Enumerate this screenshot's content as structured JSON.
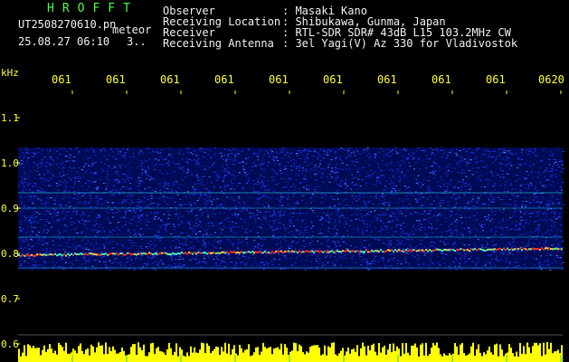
{
  "header": {
    "app_name": "HROFFT",
    "filename": "UT2508270610.pn",
    "file_suffix": "meteor",
    "timestamp": "25.08.27 06:10",
    "counter": "3..",
    "fields": [
      {
        "label": "Observer",
        "value": ": Masaki Kano"
      },
      {
        "label": "Receiving Location",
        "value": ": Shibukawa, Gunma, Japan"
      },
      {
        "label": "Receiver",
        "value": ": RTL-SDR SDR# 43dB L15 103.2MHz CW"
      },
      {
        "label": "Receiving Antenna",
        "value": ": 3el Yagi(V) Az 330 for Vladivostok"
      }
    ]
  },
  "time_axis": {
    "ticks": [
      "061",
      "061",
      "061",
      "061",
      "061",
      "061",
      "061",
      "061",
      "061",
      "0620"
    ]
  },
  "freq_axis": {
    "unit": "kHz",
    "ticks": [
      "1.1",
      "1.0",
      "0.9",
      "0.8",
      "0.7",
      "0.6"
    ]
  },
  "colors": {
    "header_text": "#f2f2f2",
    "app_name": "#4cff4c",
    "axis_labels": "#ffff33",
    "noise": "#1a2fff",
    "signal": "#ff3030",
    "background": "#000000"
  }
}
